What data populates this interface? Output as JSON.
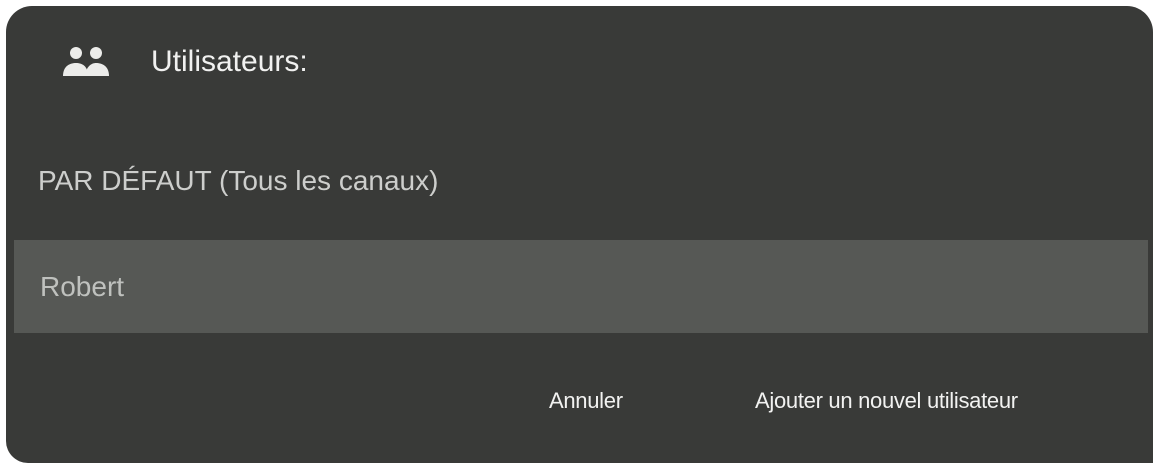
{
  "dialog": {
    "title": "Utilisateurs:",
    "title_icon": "users-icon"
  },
  "users": [
    {
      "label": "PAR DÉFAUT (Tous les canaux)",
      "selected": false
    },
    {
      "label": "Robert",
      "selected": true
    }
  ],
  "actions": {
    "cancel_label": "Annuler",
    "add_user_label": "Ajouter un nouvel utilisateur"
  },
  "colors": {
    "dialog_background": "#393a38",
    "selected_row": "#565855",
    "text_primary": "#f1f1f0",
    "text_secondary": "#cfd0ce"
  }
}
